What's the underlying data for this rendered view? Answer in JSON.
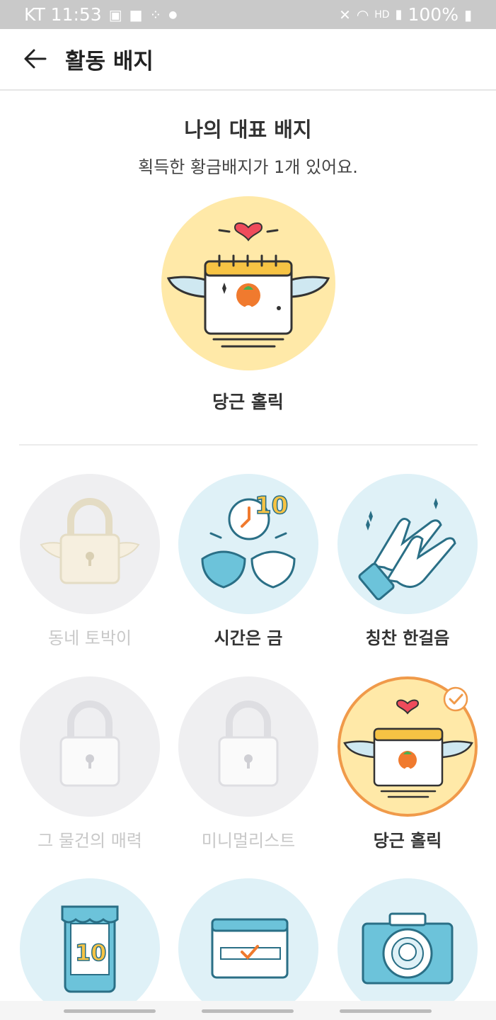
{
  "status_bar": {
    "carrier_time": "KT 11:53",
    "battery": "100%"
  },
  "app_bar": {
    "title": "활동 배지",
    "back_icon": "arrow-left-icon"
  },
  "featured": {
    "heading": "나의 대표 배지",
    "subtitle": "획득한 황금배지가 1개 있어요.",
    "badge_name": "당근 홀릭"
  },
  "badges": [
    {
      "label": "동네 토박이",
      "locked": true,
      "icon": "lock-with-wings-icon"
    },
    {
      "label": "시간은 금",
      "locked": false,
      "icon": "pinky-promise-clock-icon"
    },
    {
      "label": "칭찬 한걸음",
      "locked": false,
      "icon": "clapping-hands-icon"
    },
    {
      "label": "그 물건의 매력",
      "locked": true,
      "icon": "lock-icon"
    },
    {
      "label": "미니멀리스트",
      "locked": true,
      "icon": "lock-icon"
    },
    {
      "label": "당근 홀릭",
      "locked": false,
      "selected": true,
      "icon": "carrot-calendar-icon"
    },
    {
      "label": "",
      "locked": false,
      "icon": "phone-store-icon"
    },
    {
      "label": "",
      "locked": false,
      "icon": "calendar-check-icon"
    },
    {
      "label": "",
      "locked": false,
      "icon": "camera-icon"
    }
  ],
  "colors": {
    "gold_bg": "#ffe9a8",
    "blue_bg": "#dff1f7",
    "locked_bg": "#efeff1",
    "selected_ring": "#f09a4a",
    "carrot": "#f07a2e"
  }
}
